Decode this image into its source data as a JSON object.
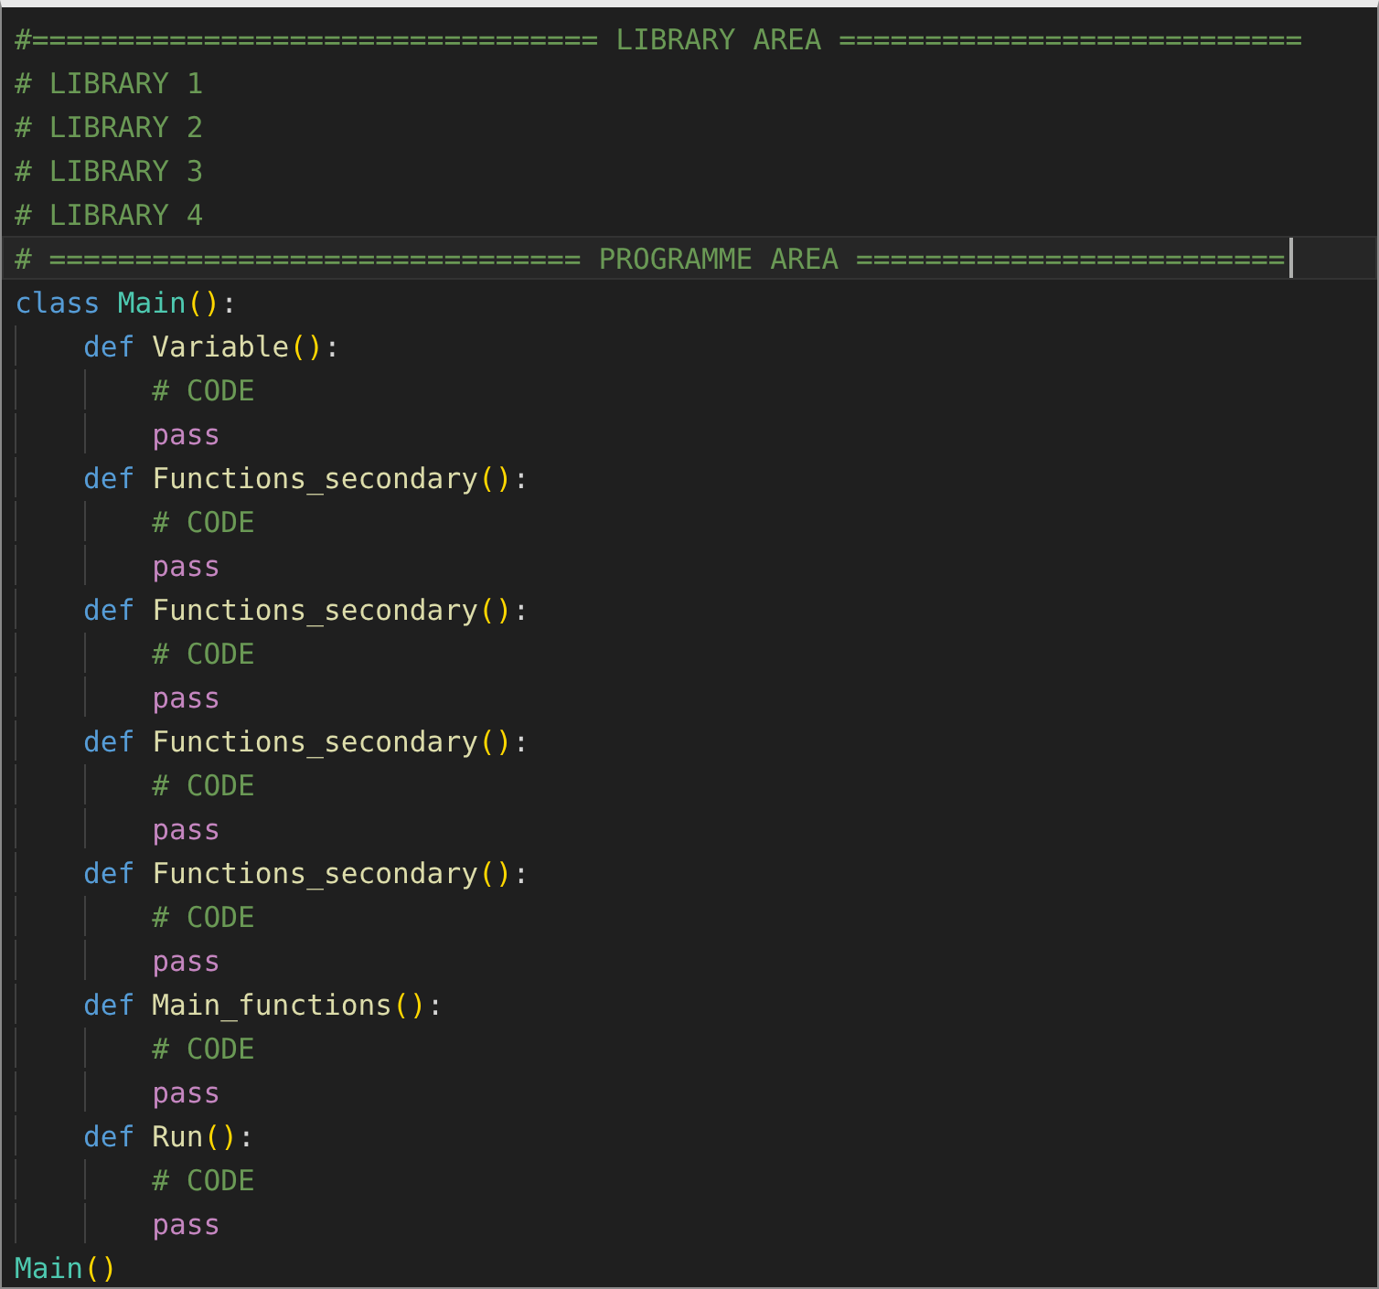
{
  "editor": {
    "lines": [
      {
        "current": false,
        "tokens": [
          {
            "text": "#================================= LIBRARY AREA ===========================",
            "kind": "comment"
          }
        ]
      },
      {
        "current": false,
        "tokens": [
          {
            "text": "# LIBRARY 1",
            "kind": "comment"
          }
        ]
      },
      {
        "current": false,
        "tokens": [
          {
            "text": "# LIBRARY 2",
            "kind": "comment"
          }
        ]
      },
      {
        "current": false,
        "tokens": [
          {
            "text": "# LIBRARY 3",
            "kind": "comment"
          }
        ]
      },
      {
        "current": false,
        "tokens": [
          {
            "text": "# LIBRARY 4",
            "kind": "comment"
          }
        ]
      },
      {
        "current": true,
        "tokens": [
          {
            "text": "# =============================== PROGRAMME AREA =========================",
            "kind": "comment"
          }
        ]
      },
      {
        "current": false,
        "tokens": [
          {
            "text": "class",
            "kind": "keyword"
          },
          {
            "text": "Main",
            "kind": "class"
          },
          {
            "text": "()",
            "kind": "bracket"
          },
          {
            "text": ":",
            "kind": "punct"
          }
        ],
        "children": [
          {
            "tokens": [
              {
                "text": "def",
                "kind": "keyword"
              },
              {
                "text": "Variable",
                "kind": "function"
              },
              {
                "text": "()",
                "kind": "bracket"
              },
              {
                "text": ":",
                "kind": "punct"
              }
            ],
            "children": [
              {
                "tokens": [
                  {
                    "text": "# CODE",
                    "kind": "comment"
                  }
                ]
              },
              {
                "tokens": [
                  {
                    "text": "pass",
                    "kind": "control"
                  }
                ]
              }
            ]
          },
          {
            "tokens": [
              {
                "text": "def",
                "kind": "keyword"
              },
              {
                "text": "Functions_secondary",
                "kind": "function"
              },
              {
                "text": "()",
                "kind": "bracket"
              },
              {
                "text": ":",
                "kind": "punct"
              }
            ],
            "children": [
              {
                "tokens": [
                  {
                    "text": "# CODE",
                    "kind": "comment"
                  }
                ]
              },
              {
                "tokens": [
                  {
                    "text": "pass",
                    "kind": "control"
                  }
                ]
              }
            ]
          },
          {
            "tokens": [
              {
                "text": "def",
                "kind": "keyword"
              },
              {
                "text": "Functions_secondary",
                "kind": "function"
              },
              {
                "text": "()",
                "kind": "bracket"
              },
              {
                "text": ":",
                "kind": "punct"
              }
            ],
            "children": [
              {
                "tokens": [
                  {
                    "text": "# CODE",
                    "kind": "comment"
                  }
                ]
              },
              {
                "tokens": [
                  {
                    "text": "pass",
                    "kind": "control"
                  }
                ]
              }
            ]
          },
          {
            "tokens": [
              {
                "text": "def",
                "kind": "keyword"
              },
              {
                "text": "Functions_secondary",
                "kind": "function"
              },
              {
                "text": "()",
                "kind": "bracket"
              },
              {
                "text": ":",
                "kind": "punct"
              }
            ],
            "children": [
              {
                "tokens": [
                  {
                    "text": "# CODE",
                    "kind": "comment"
                  }
                ]
              },
              {
                "tokens": [
                  {
                    "text": "pass",
                    "kind": "control"
                  }
                ]
              }
            ]
          },
          {
            "tokens": [
              {
                "text": "def",
                "kind": "keyword"
              },
              {
                "text": "Functions_secondary",
                "kind": "function"
              },
              {
                "text": "()",
                "kind": "bracket"
              },
              {
                "text": ":",
                "kind": "punct"
              }
            ],
            "children": [
              {
                "tokens": [
                  {
                    "text": "# CODE",
                    "kind": "comment"
                  }
                ]
              },
              {
                "tokens": [
                  {
                    "text": "pass",
                    "kind": "control"
                  }
                ]
              }
            ]
          },
          {
            "tokens": [
              {
                "text": "def",
                "kind": "keyword"
              },
              {
                "text": "Main_functions",
                "kind": "function"
              },
              {
                "text": "()",
                "kind": "bracket"
              },
              {
                "text": ":",
                "kind": "punct"
              }
            ],
            "children": [
              {
                "tokens": [
                  {
                    "text": "# CODE",
                    "kind": "comment"
                  }
                ]
              },
              {
                "tokens": [
                  {
                    "text": "pass",
                    "kind": "control"
                  }
                ]
              }
            ]
          },
          {
            "tokens": [
              {
                "text": "def",
                "kind": "keyword"
              },
              {
                "text": "Run",
                "kind": "function"
              },
              {
                "text": "()",
                "kind": "bracket"
              },
              {
                "text": ":",
                "kind": "punct"
              }
            ],
            "children": [
              {
                "tokens": [
                  {
                    "text": "# CODE",
                    "kind": "comment"
                  }
                ]
              },
              {
                "tokens": [
                  {
                    "text": "pass",
                    "kind": "control"
                  }
                ]
              }
            ]
          }
        ]
      },
      {
        "current": false,
        "tokens": [
          {
            "text": "Main",
            "kind": "class"
          },
          {
            "text": "()",
            "kind": "bracket"
          }
        ]
      }
    ]
  }
}
